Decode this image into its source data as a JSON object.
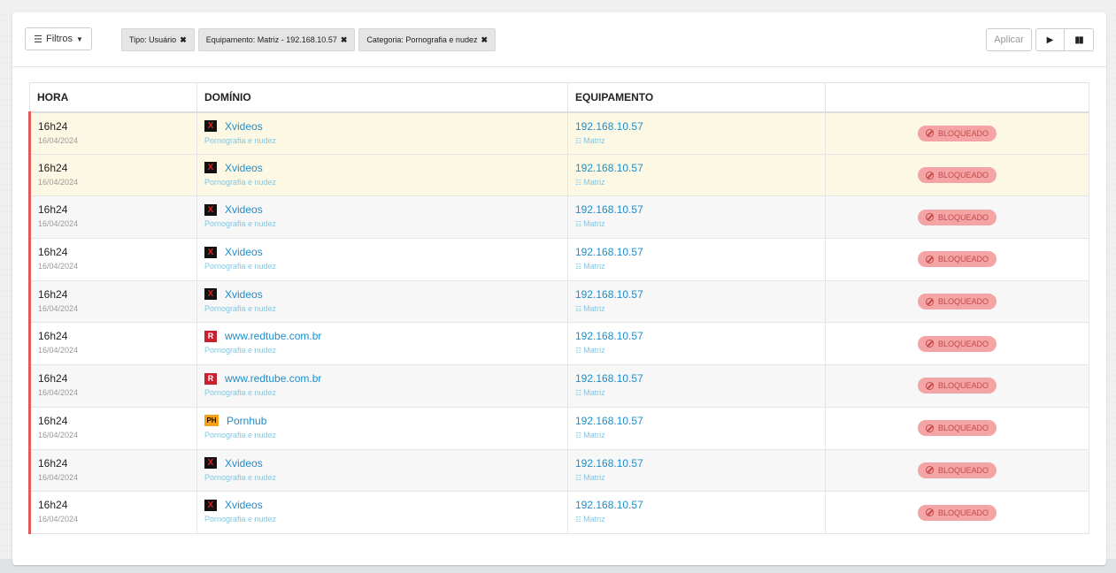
{
  "toolbar": {
    "filters_label": "Filtros",
    "chips": [
      {
        "label": "Tipo: Usuário"
      },
      {
        "label": "Equipamento: Matriz - 192.168.10.57"
      },
      {
        "label": "Categoria: Pornografia e nudez"
      }
    ],
    "apply_label": "Aplicar",
    "play_icon": "▶",
    "pause_icon": "▮▮"
  },
  "table": {
    "headers": [
      "HORA",
      "DOMÍNIO",
      "EQUIPAMENTO",
      ""
    ],
    "rows": [
      {
        "hora": "16h24",
        "data": "16/04/2024",
        "favicon": "xvideos",
        "dominio": "Xvideos",
        "categoria": "Pornografia e nudez",
        "ip": "192.168.10.57",
        "equipamento": "Matriz",
        "status": "BLOQUEADO"
      },
      {
        "hora": "16h24",
        "data": "16/04/2024",
        "favicon": "xvideos",
        "dominio": "Xvideos",
        "categoria": "Pornografia e nudez",
        "ip": "192.168.10.57",
        "equipamento": "Matriz",
        "status": "BLOQUEADO"
      },
      {
        "hora": "16h24",
        "data": "16/04/2024",
        "favicon": "xvideos",
        "dominio": "Xvideos",
        "categoria": "Pornografia e nudez",
        "ip": "192.168.10.57",
        "equipamento": "Matriz",
        "status": "BLOQUEADO"
      },
      {
        "hora": "16h24",
        "data": "16/04/2024",
        "favicon": "xvideos",
        "dominio": "Xvideos",
        "categoria": "Pornografia e nudez",
        "ip": "192.168.10.57",
        "equipamento": "Matriz",
        "status": "BLOQUEADO"
      },
      {
        "hora": "16h24",
        "data": "16/04/2024",
        "favicon": "xvideos",
        "dominio": "Xvideos",
        "categoria": "Pornografia e nudez",
        "ip": "192.168.10.57",
        "equipamento": "Matriz",
        "status": "BLOQUEADO"
      },
      {
        "hora": "16h24",
        "data": "16/04/2024",
        "favicon": "redtube",
        "dominio": "www.redtube.com.br",
        "categoria": "Pornografia e nudez",
        "ip": "192.168.10.57",
        "equipamento": "Matriz",
        "status": "BLOQUEADO"
      },
      {
        "hora": "16h24",
        "data": "16/04/2024",
        "favicon": "redtube",
        "dominio": "www.redtube.com.br",
        "categoria": "Pornografia e nudez",
        "ip": "192.168.10.57",
        "equipamento": "Matriz",
        "status": "BLOQUEADO"
      },
      {
        "hora": "16h24",
        "data": "16/04/2024",
        "favicon": "pornhub",
        "dominio": "Pornhub",
        "categoria": "Pornografia e nudez",
        "ip": "192.168.10.57",
        "equipamento": "Matriz",
        "status": "BLOQUEADO"
      },
      {
        "hora": "16h24",
        "data": "16/04/2024",
        "favicon": "xvideos",
        "dominio": "Xvideos",
        "categoria": "Pornografia e nudez",
        "ip": "192.168.10.57",
        "equipamento": "Matriz",
        "status": "BLOQUEADO"
      },
      {
        "hora": "16h24",
        "data": "16/04/2024",
        "favicon": "xvideos",
        "dominio": "Xvideos",
        "categoria": "Pornografia e nudez",
        "ip": "192.168.10.57",
        "equipamento": "Matriz",
        "status": "BLOQUEADO"
      }
    ]
  },
  "favicons": {
    "xvideos": {
      "glyph": "X"
    },
    "redtube": {
      "glyph": "R"
    },
    "pornhub": {
      "glyph": "PH"
    }
  },
  "colors": {
    "highlight_row": "#fcf8e3",
    "row_marker": "#e05c5c",
    "link": "#1f8dc9",
    "badge_bg": "#f4a4a4",
    "badge_text": "#c34b4b"
  }
}
